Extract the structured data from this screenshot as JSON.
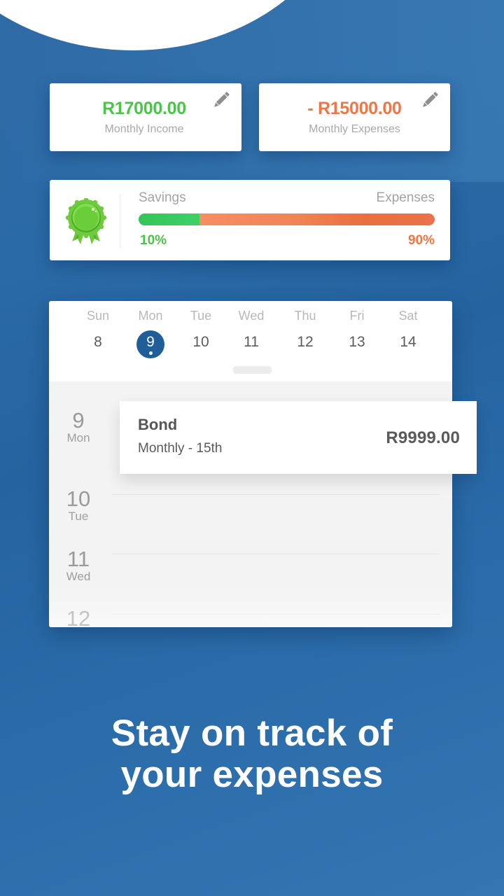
{
  "summary": {
    "income": {
      "amount": "R17000.00",
      "label": "Monthly Income",
      "color": "#4cc349",
      "edit_icon": "pencil-icon"
    },
    "expenses": {
      "amount": "- R15000.00",
      "label": "Monthly Expenses",
      "color": "#ec7849",
      "edit_icon": "pencil-icon"
    }
  },
  "savings_bar": {
    "icon": "award-ribbon-icon",
    "left_label": "Savings",
    "right_label": "Expenses",
    "savings_percent": 10,
    "expenses_percent": 90,
    "savings_percent_text": "10%",
    "expenses_percent_text": "90%",
    "savings_color": "#3ecf66",
    "expenses_color": "#e8734a"
  },
  "calendar": {
    "week": [
      {
        "name": "Sun",
        "num": "8",
        "selected": false
      },
      {
        "name": "Mon",
        "num": "9",
        "selected": true
      },
      {
        "name": "Tue",
        "num": "10",
        "selected": false
      },
      {
        "name": "Wed",
        "num": "11",
        "selected": false
      },
      {
        "name": "Thu",
        "num": "12",
        "selected": false
      },
      {
        "name": "Fri",
        "num": "13",
        "selected": false
      },
      {
        "name": "Sat",
        "num": "14",
        "selected": false
      }
    ],
    "selected_color": "#1f5e98",
    "agenda": [
      {
        "num": "9",
        "name": "Mon"
      },
      {
        "num": "10",
        "name": "Tue"
      },
      {
        "num": "11",
        "name": "Wed"
      },
      {
        "num": "12",
        "name": ""
      }
    ],
    "event": {
      "title": "Bond",
      "subtitle": "Monthly - 15th",
      "amount": "R9999.00"
    }
  },
  "tagline": {
    "line1": "Stay on track of",
    "line2": "your expenses"
  },
  "colors": {
    "background": "#2a69a6",
    "white": "#ffffff"
  }
}
